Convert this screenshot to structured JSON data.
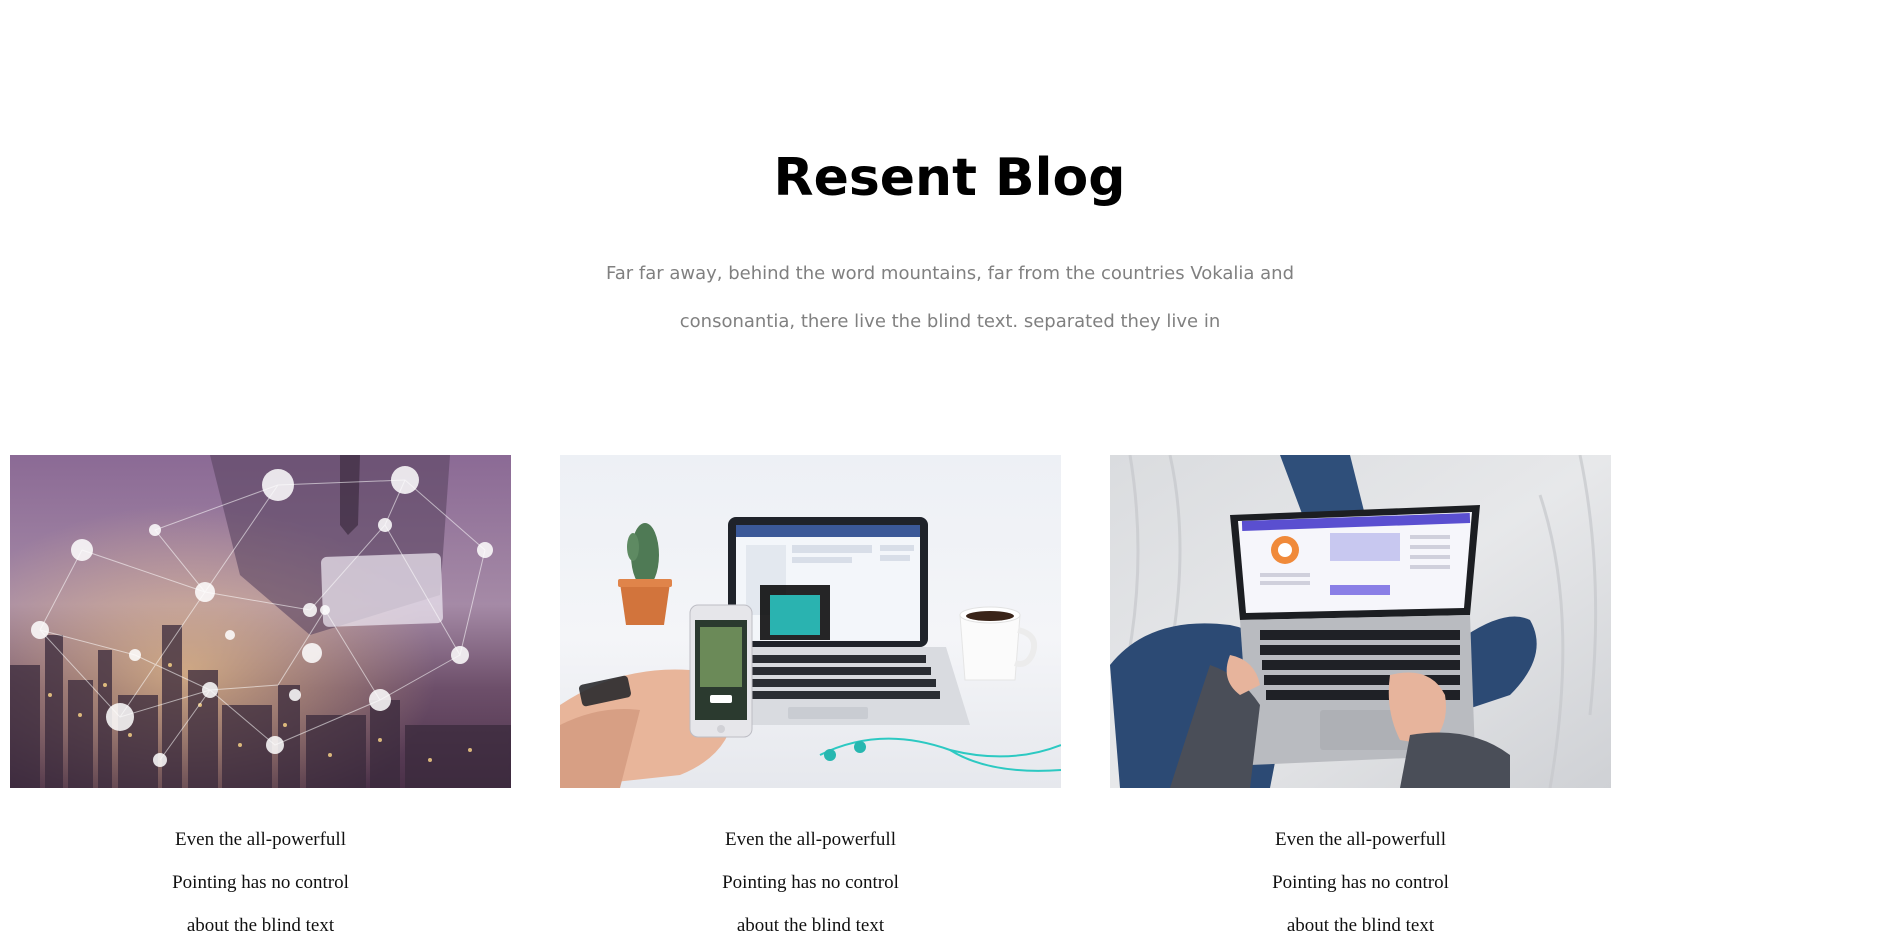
{
  "section": {
    "title": "Resent Blog",
    "subtitle_line_1": "Far far away, behind the word mountains, far from the countries Vokalia and",
    "subtitle_line_2": "consonantia, there live the blind text. separated they live in"
  },
  "posts": [
    {
      "image": "network-city-tablet-photo",
      "caption_line_1": "Even the all-powerfull",
      "caption_line_2": "Pointing has no control",
      "caption_line_3": "about the blind text"
    },
    {
      "image": "laptop-phone-desk-photo",
      "caption_line_1": "Even the all-powerfull",
      "caption_line_2": "Pointing has no control",
      "caption_line_3": "about the blind text"
    },
    {
      "image": "laptop-on-lap-photo",
      "caption_line_1": "Even the all-powerfull",
      "caption_line_2": "Pointing has no control",
      "caption_line_3": "about the blind text"
    }
  ]
}
